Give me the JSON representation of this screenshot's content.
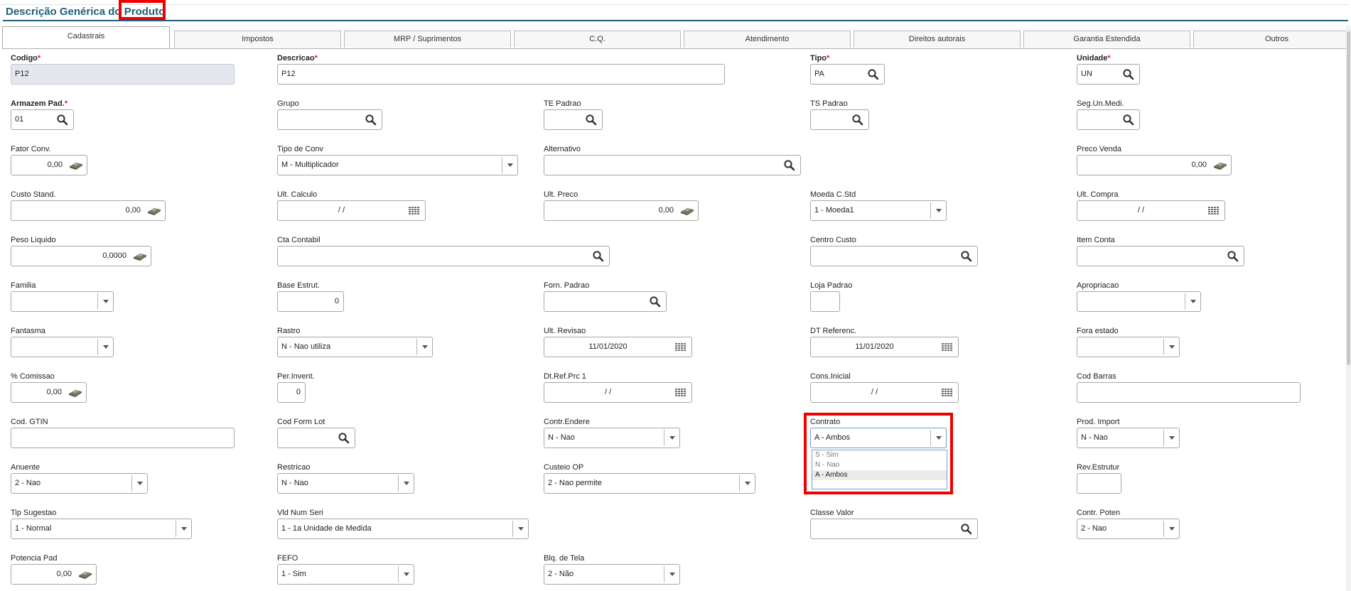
{
  "page": {
    "title_prefix": "Descrição Genérica do ",
    "title_highlight": "Produto"
  },
  "tabs": [
    "Cadastrais",
    "Impostos",
    "MRP / Suprimentos",
    "C.Q.",
    "Atendimento",
    "Direitos autorais",
    "Garantia Estendida",
    "Outros"
  ],
  "active_tab": "Cadastrais",
  "required_marker": "*",
  "fields": {
    "codigo": {
      "label": "Codigo",
      "value": "P12"
    },
    "descricao": {
      "label": "Descricao",
      "value": "P12"
    },
    "tipo": {
      "label": "Tipo",
      "value": "PA"
    },
    "unidade": {
      "label": "Unidade",
      "value": "UN"
    },
    "armazem_pad": {
      "label": "Armazem Pad.",
      "value": "01"
    },
    "grupo": {
      "label": "Grupo",
      "value": ""
    },
    "te_padrao": {
      "label": "TE Padrao",
      "value": ""
    },
    "ts_padrao": {
      "label": "TS Padrao",
      "value": ""
    },
    "seg_un_medi": {
      "label": "Seg.Un.Medi.",
      "value": ""
    },
    "fator_conv": {
      "label": "Fator Conv.",
      "value": "0,00"
    },
    "tipo_de_conv": {
      "label": "Tipo de Conv",
      "value": "M - Multiplicador"
    },
    "alternativo": {
      "label": "Alternativo",
      "value": ""
    },
    "preco_venda": {
      "label": "Preco Venda",
      "value": "0,00"
    },
    "custo_stand": {
      "label": "Custo Stand.",
      "value": "0,00"
    },
    "ult_calculo": {
      "label": "Ult. Calculo",
      "value": "/ /"
    },
    "ult_preco": {
      "label": "Ult. Preco",
      "value": "0,00"
    },
    "moeda_c_std": {
      "label": "Moeda C.Std",
      "value": "1 - Moeda1"
    },
    "ult_compra": {
      "label": "Ult. Compra",
      "value": "/ /"
    },
    "peso_liquido": {
      "label": "Peso Liquido",
      "value": "0,0000"
    },
    "cta_contabil": {
      "label": "Cta Contabil",
      "value": ""
    },
    "centro_custo": {
      "label": "Centro Custo",
      "value": ""
    },
    "item_conta": {
      "label": "Item Conta",
      "value": ""
    },
    "familia": {
      "label": "Familia",
      "value": ""
    },
    "base_estrut": {
      "label": "Base Estrut.",
      "value": "0"
    },
    "forn_padrao": {
      "label": "Forn. Padrao",
      "value": ""
    },
    "loja_padrao": {
      "label": "Loja Padrao",
      "value": ""
    },
    "apropriacao": {
      "label": "Apropriacao",
      "value": ""
    },
    "fantasma": {
      "label": "Fantasma",
      "value": ""
    },
    "rastro": {
      "label": "Rastro",
      "value": "N - Nao utiliza"
    },
    "ult_revisao": {
      "label": "Ult. Revisao",
      "value": "11/01/2020"
    },
    "dt_referenc": {
      "label": "DT Referenc.",
      "value": "11/01/2020"
    },
    "fora_estado": {
      "label": "Fora estado",
      "value": ""
    },
    "comissao": {
      "label": "% Comissao",
      "value": "0,00"
    },
    "per_invent": {
      "label": "Per.Invent.",
      "value": "0"
    },
    "dt_ref_prc_1": {
      "label": "Dt.Ref.Prc 1",
      "value": "/ /"
    },
    "cons_inicial": {
      "label": "Cons.Inicial",
      "value": "/ /"
    },
    "cod_barras": {
      "label": "Cod Barras",
      "value": ""
    },
    "cod_gtin": {
      "label": "Cod. GTIN",
      "value": ""
    },
    "cod_form_lot": {
      "label": "Cod Form Lot",
      "value": ""
    },
    "contr_endere": {
      "label": "Contr.Endere",
      "value": "N - Nao"
    },
    "contrato": {
      "label": "Contrato",
      "value": "A - Ambos"
    },
    "prod_import": {
      "label": "Prod. Import",
      "value": "N - Nao"
    },
    "anuente": {
      "label": "Anuente",
      "value": "2 - Nao"
    },
    "restricao": {
      "label": "Restricao",
      "value": "N - Nao"
    },
    "custeio_op": {
      "label": "Custeio OP",
      "value": "2 - Nao permite"
    },
    "rev_estrutur": {
      "label": "Rev.Estrutur",
      "value": ""
    },
    "tip_sugestao": {
      "label": "Tip Sugestao",
      "value": "1 - Normal"
    },
    "vld_num_seri": {
      "label": "Vld Num Seri",
      "value": "1 - 1a Unidade de Medida"
    },
    "classe_valor": {
      "label": "Classe Valor",
      "value": ""
    },
    "contr_poten": {
      "label": "Contr. Poten",
      "value": "2 - Nao"
    },
    "potencia_pad": {
      "label": "Potencia Pad",
      "value": "0,00"
    },
    "fefo": {
      "label": "FEFO",
      "value": "1 - Sim"
    },
    "blq_de_tela": {
      "label": "Blq. de Tela",
      "value": "2 - Não"
    }
  },
  "contrato_options": [
    "S - Sim",
    "N - Nao",
    "A - Ambos"
  ],
  "colors": {
    "title": "#1f5f7a",
    "highlight": "#ee0000",
    "required": "#e02020"
  }
}
